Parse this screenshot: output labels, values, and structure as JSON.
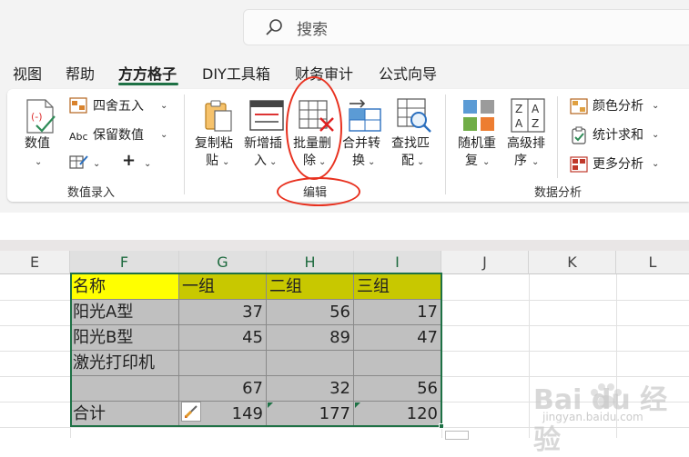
{
  "search": {
    "placeholder": "搜索"
  },
  "tabs": [
    {
      "label": "视图",
      "active": false
    },
    {
      "label": "帮助",
      "active": false
    },
    {
      "label": "方方格子",
      "active": true
    },
    {
      "label": "DIY工具箱",
      "active": false
    },
    {
      "label": "财务审计",
      "active": false
    },
    {
      "label": "公式向导",
      "active": false
    }
  ],
  "ribbon": {
    "numeric_group": {
      "label": "数值录入",
      "numeric_button": "数值",
      "round_button": "四舍五入",
      "keep_value_button": "保留数值",
      "abc_prefix": "Abc",
      "plus_label": "+"
    },
    "edit_group": {
      "label": "编辑",
      "copy_paste_1": "复制粘",
      "copy_paste_2": "贴",
      "insert_1": "新增插",
      "insert_2": "入",
      "batch_delete_1": "批量删",
      "batch_delete_2": "除",
      "merge_1": "合并转",
      "merge_2": "换",
      "find_1": "查找匹",
      "find_2": "配"
    },
    "analysis_group": {
      "label": "数据分析",
      "random_1": "随机重",
      "random_2": "复",
      "sort_1": "高级排",
      "sort_2": "序",
      "color_analysis": "颜色分析",
      "stat_sum": "统计求和",
      "more_analysis": "更多分析"
    }
  },
  "sheet": {
    "columns": [
      "E",
      "F",
      "G",
      "H",
      "I",
      "J",
      "K",
      "L"
    ],
    "rows": [
      [
        "名称",
        "一组",
        "二组",
        "三组"
      ],
      [
        "阳光A型",
        "37",
        "56",
        "17"
      ],
      [
        "阳光B型",
        "45",
        "89",
        "47"
      ],
      [
        "激光打印机",
        "",
        "",
        ""
      ],
      [
        "",
        "67",
        "32",
        "56"
      ],
      [
        "合计",
        "149",
        "177",
        "120"
      ]
    ]
  },
  "watermark": {
    "brand": "Bai du 经验",
    "url": "jingyan.baidu.com"
  },
  "colors": {
    "accent": "#1e7145",
    "annotation": "#e8311f",
    "header_yellow": "#ffff00",
    "header_olive": "#c8c800",
    "cell_gray": "#c0c0c0"
  }
}
